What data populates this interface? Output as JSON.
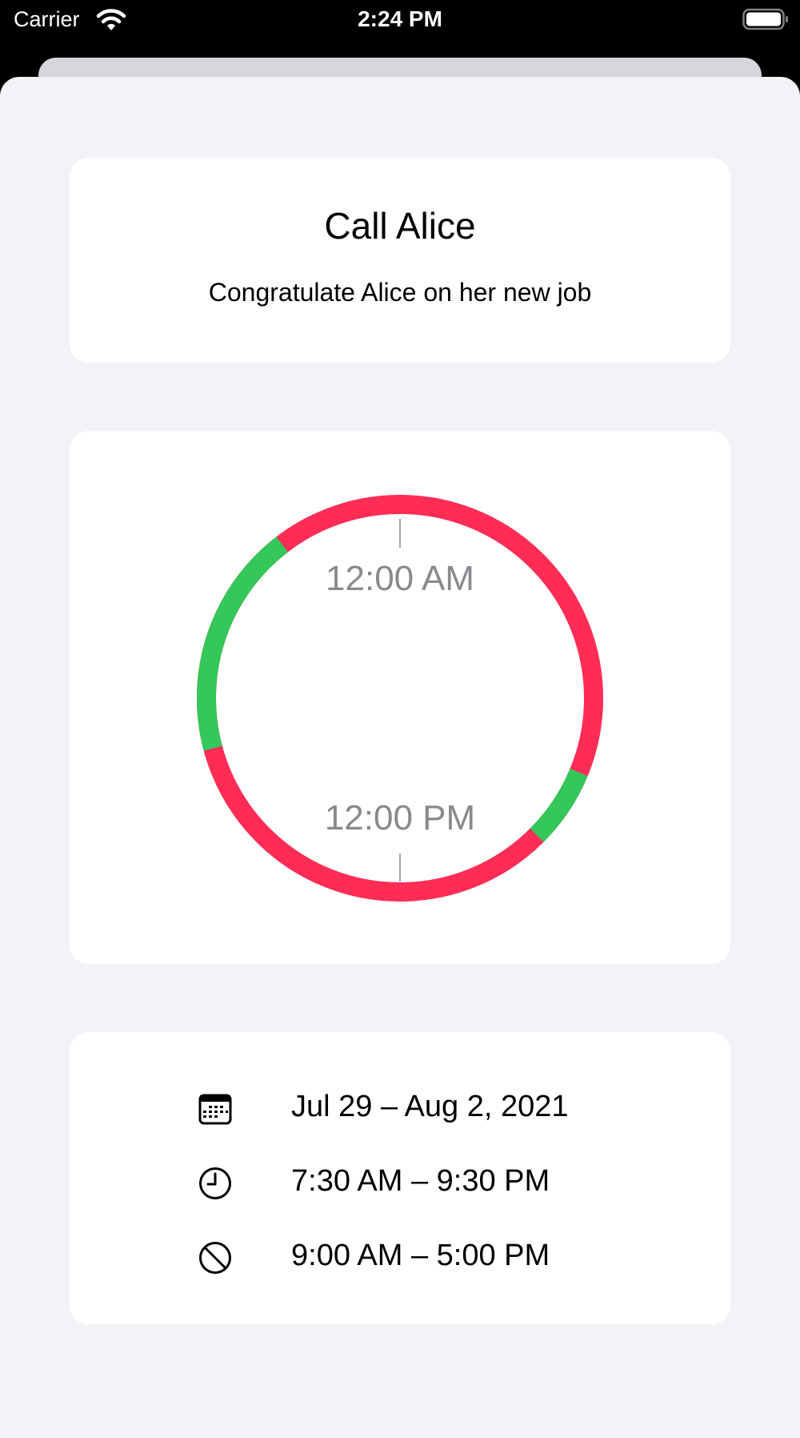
{
  "status_bar": {
    "carrier": "Carrier",
    "time": "2:24 PM"
  },
  "task": {
    "title": "Call Alice",
    "subtitle": "Congratulate Alice on her new job"
  },
  "clock_ring": {
    "top_label": "12:00 AM",
    "bottom_label": "12:00 PM",
    "colors": {
      "red": "#ff2d55",
      "green": "#34c759"
    },
    "segments": [
      {
        "start": "12:00 AM",
        "end": "5:00 PM",
        "color": "red"
      },
      {
        "start": "5:00 PM",
        "end": "9:00 PM",
        "color": "red"
      },
      {
        "start": "7:30 AM",
        "end": "9:00 AM",
        "color": "green"
      },
      {
        "start": "5:00 PM",
        "end": "9:30 PM",
        "color": "green"
      }
    ]
  },
  "details": [
    {
      "icon": "calendar-icon",
      "text": "Jul 29 – Aug 2, 2021"
    },
    {
      "icon": "clock-icon",
      "text": "7:30 AM – 9:30 PM"
    },
    {
      "icon": "prohibited-icon",
      "text": "9:00 AM – 5:00 PM"
    }
  ]
}
